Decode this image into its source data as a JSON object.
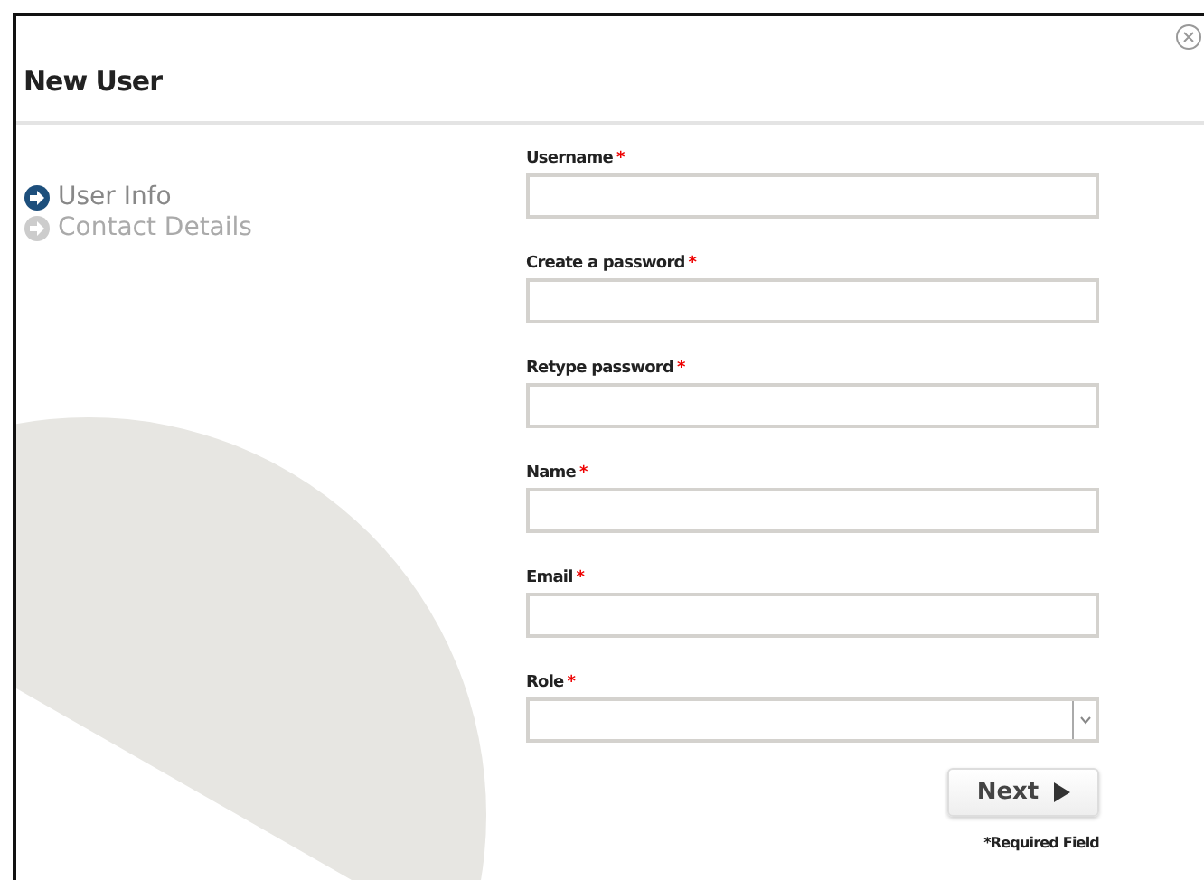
{
  "window": {
    "title": "New User"
  },
  "steps": [
    {
      "label": "User Info",
      "selected": true
    },
    {
      "label": "Contact Details",
      "selected": false
    }
  ],
  "fields": [
    {
      "label": "Username",
      "required_mark": "*",
      "kind": "text"
    },
    {
      "label": "Create a password",
      "required_mark": "*",
      "kind": "password"
    },
    {
      "label": "Retype password",
      "required_mark": "*",
      "kind": "password"
    },
    {
      "label": "Name",
      "required_mark": "*",
      "kind": "text"
    },
    {
      "label": "Email",
      "required_mark": "*",
      "kind": "text"
    },
    {
      "label": "Role",
      "required_mark": "*",
      "kind": "select"
    }
  ],
  "next_button": {
    "label": "Next"
  },
  "footnote": "*Required Field"
}
